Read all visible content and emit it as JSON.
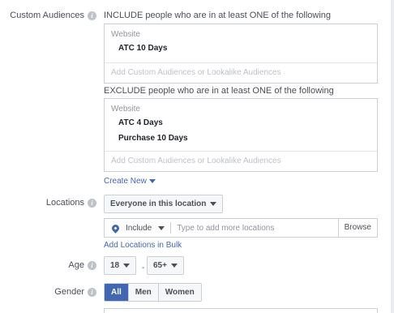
{
  "custom_audiences": {
    "label": "Custom Audiences",
    "include_heading": "INCLUDE people who are in at least ONE of the following",
    "include": {
      "category": "Website",
      "items": [
        "ATC 10 Days"
      ],
      "add_placeholder": "Add Custom Audiences or Lookalike Audiences"
    },
    "exclude_heading": "EXCLUDE people who are in at least ONE of the following",
    "exclude": {
      "category": "Website",
      "items": [
        "ATC 4 Days",
        "Purchase 10 Days"
      ],
      "add_placeholder": "Add Custom Audiences or Lookalike Audiences"
    },
    "create_new": "Create New"
  },
  "locations": {
    "label": "Locations",
    "dropdown_value": "Everyone in this location",
    "include_label": "Include",
    "search_placeholder": "Type to add more locations",
    "browse_label": "Browse",
    "bulk_link": "Add Locations in Bulk"
  },
  "age": {
    "label": "Age",
    "min": "18",
    "separator": "-",
    "max": "65+"
  },
  "gender": {
    "label": "Gender",
    "options": [
      "All",
      "Men",
      "Women"
    ],
    "selected": "All"
  },
  "colors": {
    "accent": "#4267b2",
    "border": "#ccd0d5",
    "muted_text": "#90949c"
  }
}
